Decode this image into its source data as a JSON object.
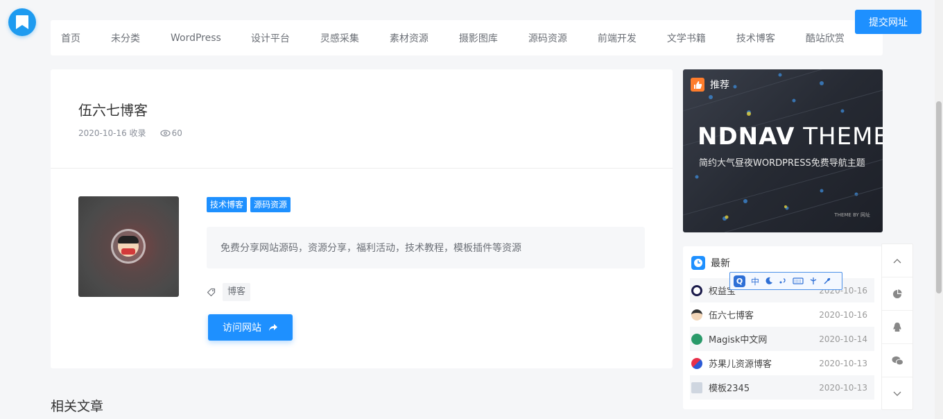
{
  "header": {
    "nav": [
      "首页",
      "未分类",
      "WordPress",
      "设计平台",
      "灵感采集",
      "素材资源",
      "摄影图库",
      "源码资源",
      "前端开发",
      "文学书籍",
      "技术博客",
      "酷站欣赏"
    ],
    "submit_label": "提交网址"
  },
  "site": {
    "title": "伍六七博客",
    "date": "2020-10-16 收录",
    "views": "60",
    "tags": [
      "技术博客",
      "源码资源"
    ],
    "description": "免费分享网站源码，资源分享，福利活动，技术教程，模板插件等资源",
    "keyword": "博客",
    "visit_label": "访问网站"
  },
  "related": {
    "title": "相关文章"
  },
  "promo": {
    "label": "推荐",
    "title_bold": "NDNAV",
    "title_light": " THEME",
    "subtitle": "简约大气昼夜WORDPRESS免费导航主题",
    "credit": "THEME BY 网址"
  },
  "latest": {
    "title": "最新",
    "items": [
      {
        "name": "权益宝",
        "date": "2020-10-16"
      },
      {
        "name": "伍六七博客",
        "date": "2020-10-16"
      },
      {
        "name": "Magisk中文网",
        "date": "2020-10-14"
      },
      {
        "name": "苏果儿资源博客",
        "date": "2020-10-13"
      },
      {
        "name": "模板2345",
        "date": "2020-10-13"
      }
    ]
  },
  "ime": {
    "q": "Q",
    "lang": "中"
  },
  "colors": {
    "accent": "#1e90ff",
    "promo_orange": "#ff7d2c",
    "page_bg": "#f5f6f8"
  }
}
